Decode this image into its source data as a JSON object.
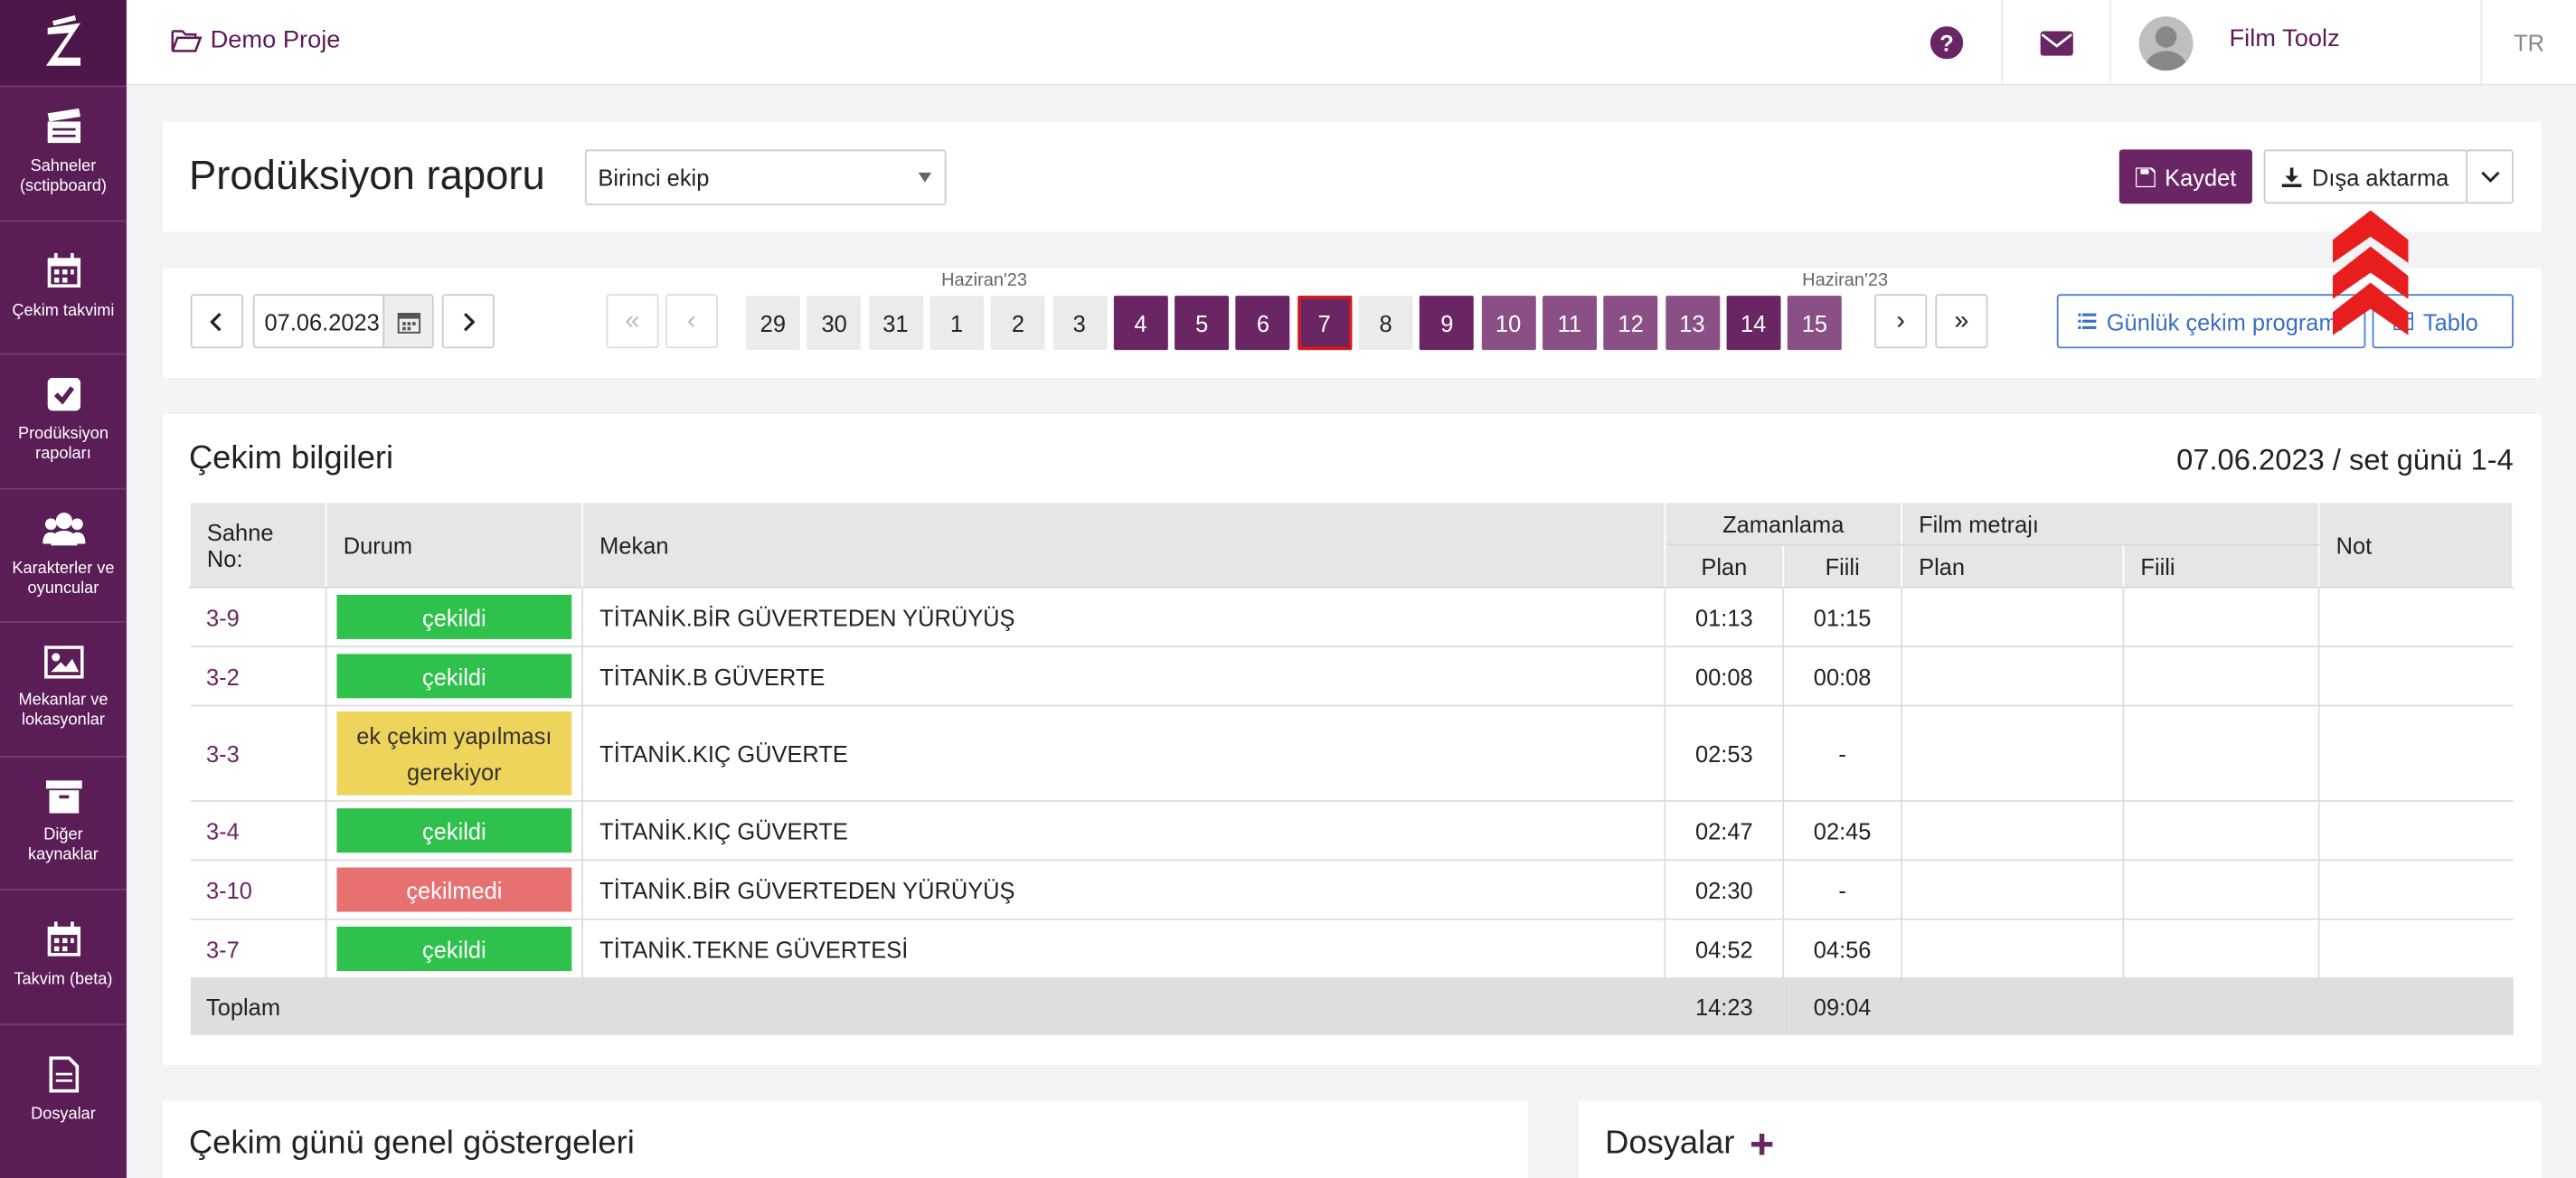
{
  "sidebar": {
    "items": [
      {
        "label": "Sahneler (sctipboard)"
      },
      {
        "label": "Çekim takvimi"
      },
      {
        "label": "Prodüksiyon rapoları"
      },
      {
        "label": "Karakterler ve oyuncular"
      },
      {
        "label": "Mekanlar ve lokasyonlar"
      },
      {
        "label": "Diğer kaynaklar"
      },
      {
        "label": "Takvim (beta)"
      },
      {
        "label": "Dosyalar"
      }
    ]
  },
  "topbar": {
    "project": "Demo Proje",
    "user": "Film Toolz",
    "lang": "TR"
  },
  "header": {
    "title": "Prodüksiyon raporu",
    "crew_select": "Birinci ekip",
    "save_label": "Kaydet",
    "export_label": "Dışa aktarma"
  },
  "datenav": {
    "date": "07.06.2023",
    "month_labels": [
      "Haziran'23",
      "Haziran'23"
    ],
    "days": [
      {
        "n": "29",
        "style": "plain"
      },
      {
        "n": "30",
        "style": "plain"
      },
      {
        "n": "31",
        "style": "plain"
      },
      {
        "n": "1",
        "style": "plain"
      },
      {
        "n": "2",
        "style": "plain"
      },
      {
        "n": "3",
        "style": "plain"
      },
      {
        "n": "4",
        "style": "dark"
      },
      {
        "n": "5",
        "style": "dark"
      },
      {
        "n": "6",
        "style": "dark"
      },
      {
        "n": "7",
        "style": "selected"
      },
      {
        "n": "8",
        "style": "plain"
      },
      {
        "n": "9",
        "style": "dark"
      },
      {
        "n": "10",
        "style": "mid"
      },
      {
        "n": "11",
        "style": "mid"
      },
      {
        "n": "12",
        "style": "mid"
      },
      {
        "n": "13",
        "style": "mid"
      },
      {
        "n": "14",
        "style": "dark"
      },
      {
        "n": "15",
        "style": "mid"
      }
    ],
    "first": "«",
    "prev": "‹",
    "next": "›",
    "last": "»",
    "daily_program": "Günlük çekim programı",
    "table_label": "Tablo"
  },
  "shooting": {
    "title": "Çekim bilgileri",
    "summary": "07.06.2023 / set günü 1-4",
    "headers": {
      "scene": "Sahne No:",
      "status": "Durum",
      "location": "Mekan",
      "timing": "Zamanlama",
      "footage": "Film metrajı",
      "note": "Not",
      "plan": "Plan",
      "actual": "Fiili"
    },
    "rows": [
      {
        "scene": "3-9",
        "status": "çekildi",
        "status_type": "green",
        "location": "TİTANİK.BİR GÜVERTEDEN YÜRÜYÜŞ",
        "plan": "01:13",
        "actual": "01:15"
      },
      {
        "scene": "3-2",
        "status": "çekildi",
        "status_type": "green",
        "location": "TİTANİK.B GÜVERTE",
        "plan": "00:08",
        "actual": "00:08"
      },
      {
        "scene": "3-3",
        "status": "ek çekim yapılması gerekiyor",
        "status_type": "yellow",
        "location": "TİTANİK.KIÇ GÜVERTE",
        "plan": "02:53",
        "actual": "-"
      },
      {
        "scene": "3-4",
        "status": "çekildi",
        "status_type": "green",
        "location": "TİTANİK.KIÇ GÜVERTE",
        "plan": "02:47",
        "actual": "02:45"
      },
      {
        "scene": "3-10",
        "status": "çekilmedi",
        "status_type": "red",
        "location": "TİTANİK.BİR GÜVERTEDEN YÜRÜYÜŞ",
        "plan": "02:30",
        "actual": "-"
      },
      {
        "scene": "3-7",
        "status": "çekildi",
        "status_type": "green",
        "location": "TİTANİK.TEKNE GÜVERTESİ",
        "plan": "04:52",
        "actual": "04:56"
      }
    ],
    "total_label": "Toplam",
    "total_plan": "14:23",
    "total_actual": "09:04"
  },
  "bottom": {
    "indicators_title": "Çekim günü genel göstergeleri",
    "files_title": "Dosyalar"
  },
  "colors": {
    "brand": "#6a2664",
    "sidebar": "#5b1d56",
    "green": "#2ec24c",
    "yellow": "#efd45c",
    "red": "#e77171"
  }
}
